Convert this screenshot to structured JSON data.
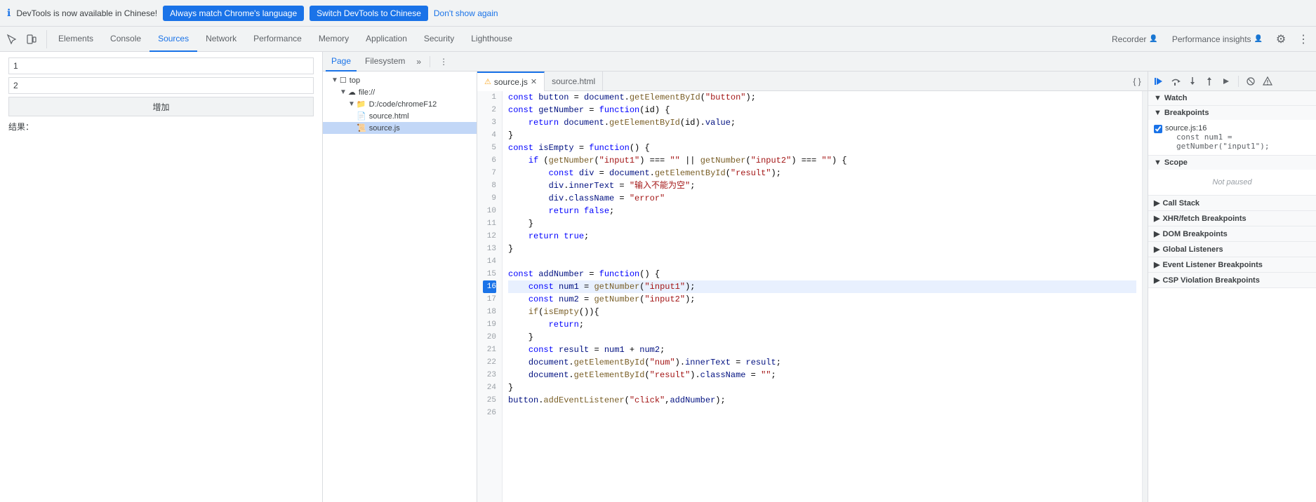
{
  "banner": {
    "info_text": "DevTools is now available in Chinese!",
    "btn1_label": "Always match Chrome's language",
    "btn2_label": "Switch DevTools to Chinese",
    "btn3_label": "Don't show again"
  },
  "toolbar": {
    "tabs": [
      {
        "id": "elements",
        "label": "Elements",
        "active": false
      },
      {
        "id": "console",
        "label": "Console",
        "active": false
      },
      {
        "id": "sources",
        "label": "Sources",
        "active": true
      },
      {
        "id": "network",
        "label": "Network",
        "active": false
      },
      {
        "id": "performance",
        "label": "Performance",
        "active": false
      },
      {
        "id": "memory",
        "label": "Memory",
        "active": false
      },
      {
        "id": "application",
        "label": "Application",
        "active": false
      },
      {
        "id": "security",
        "label": "Security",
        "active": false
      },
      {
        "id": "lighthouse",
        "label": "Lighthouse",
        "active": false
      }
    ],
    "right_tabs": [
      {
        "id": "recorder",
        "label": "Recorder"
      },
      {
        "id": "performance-insights",
        "label": "Performance insights"
      }
    ]
  },
  "sources_panel": {
    "tabs": [
      {
        "id": "page",
        "label": "Page",
        "active": true
      },
      {
        "id": "filesystem",
        "label": "Filesystem",
        "active": false
      }
    ],
    "file_tree": {
      "items": [
        {
          "id": "top",
          "label": "top",
          "indent": 1,
          "type": "folder",
          "open": true
        },
        {
          "id": "file",
          "label": "file://",
          "indent": 2,
          "type": "cloud",
          "open": true
        },
        {
          "id": "dcode",
          "label": "D:/code/chromeF12",
          "indent": 3,
          "type": "folder",
          "open": true
        },
        {
          "id": "source-html",
          "label": "source.html",
          "indent": 4,
          "type": "file"
        },
        {
          "id": "source-js",
          "label": "source.js",
          "indent": 4,
          "type": "file-js",
          "selected": true
        }
      ]
    }
  },
  "editor": {
    "tabs": [
      {
        "id": "source-js",
        "label": "source.js",
        "warn": true,
        "active": true
      },
      {
        "id": "source-html",
        "label": "source.html",
        "warn": false,
        "active": false
      }
    ],
    "active_line": 16
  },
  "debug_panel": {
    "toolbar_buttons": [
      "resume",
      "step-over",
      "step-into",
      "step-out",
      "step",
      "deactivate",
      "pause-on-exceptions"
    ],
    "sections": [
      {
        "id": "watch",
        "label": "Watch",
        "expanded": true,
        "content": []
      },
      {
        "id": "breakpoints",
        "label": "Breakpoints",
        "expanded": true,
        "breakpoints": [
          {
            "file": "source.js:16",
            "code": "const num1 = getNumber(\"input1\");"
          }
        ]
      },
      {
        "id": "scope",
        "label": "Scope",
        "expanded": true,
        "not_paused": "Not paused"
      },
      {
        "id": "call-stack",
        "label": "Call Stack",
        "expanded": false
      },
      {
        "id": "xhr-fetch",
        "label": "XHR/fetch Breakpoints",
        "expanded": false
      },
      {
        "id": "dom-breakpoints",
        "label": "DOM Breakpoints",
        "expanded": false
      },
      {
        "id": "global-listeners",
        "label": "Global Listeners",
        "expanded": false
      },
      {
        "id": "event-listener",
        "label": "Event Listener Breakpoints",
        "expanded": false
      },
      {
        "id": "csp-violation",
        "label": "CSP Violation Breakpoints",
        "expanded": false
      }
    ]
  },
  "webpage": {
    "input1_value": "1",
    "input2_value": "2",
    "button_label": "增加",
    "result_label": "结果："
  }
}
